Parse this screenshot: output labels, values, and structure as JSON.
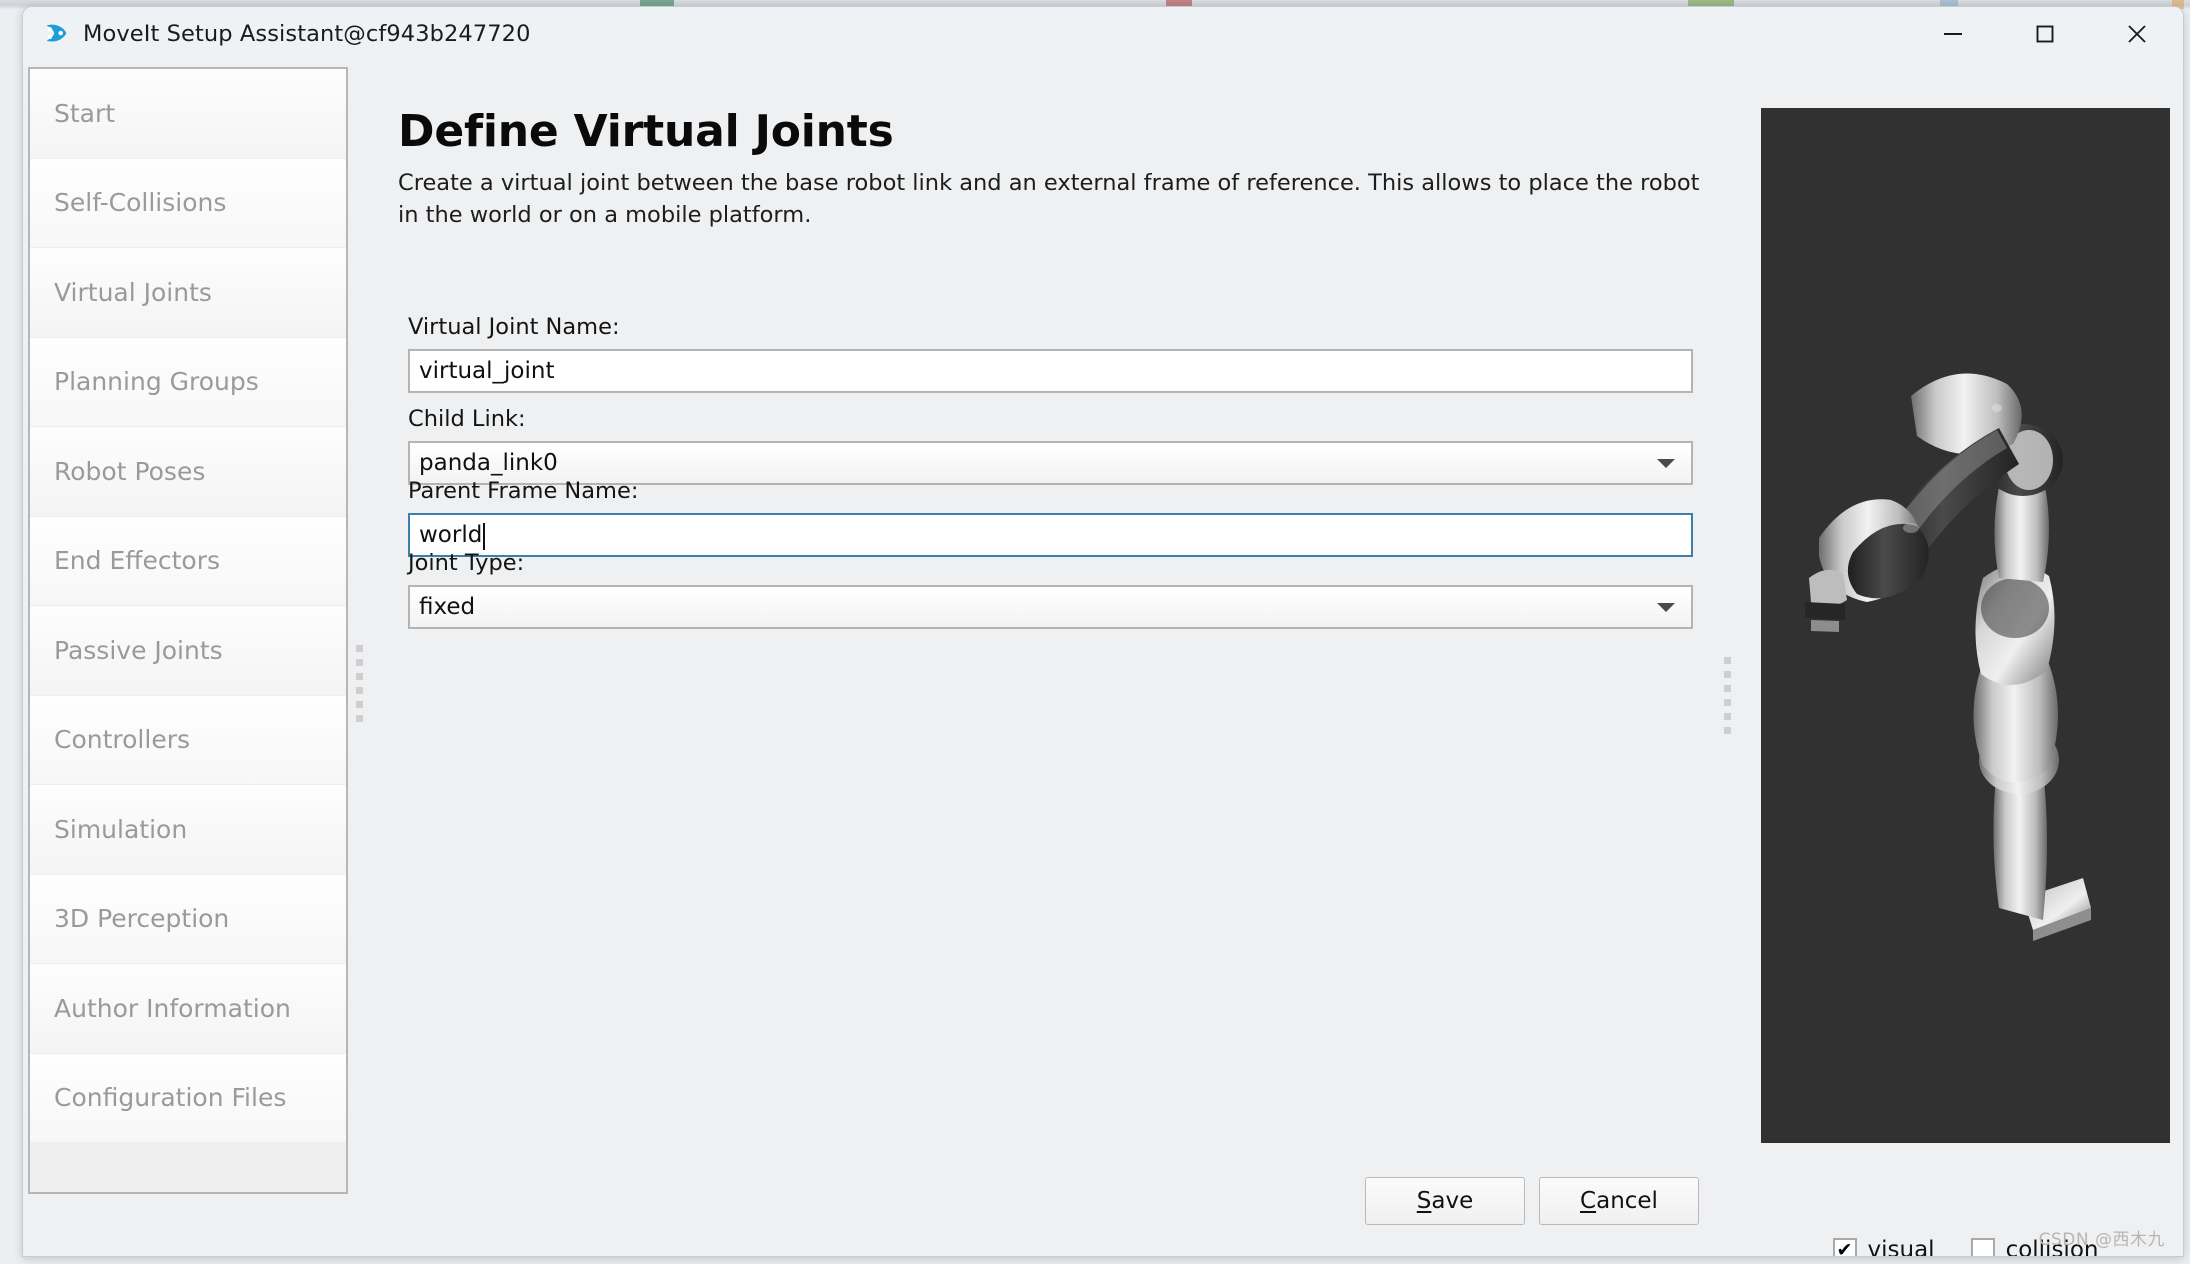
{
  "window": {
    "title": "MoveIt Setup Assistant@cf943b247720",
    "app_icon": "moveit-logo-icon",
    "controls": {
      "minimize": "minimize-icon",
      "maximize": "maximize-icon",
      "close": "close-icon"
    }
  },
  "sidebar": {
    "items": [
      {
        "label": "Start"
      },
      {
        "label": "Self-Collisions"
      },
      {
        "label": "Virtual Joints"
      },
      {
        "label": "Planning Groups"
      },
      {
        "label": "Robot Poses"
      },
      {
        "label": "End Effectors"
      },
      {
        "label": "Passive Joints"
      },
      {
        "label": "Controllers"
      },
      {
        "label": "Simulation"
      },
      {
        "label": "3D Perception"
      },
      {
        "label": "Author Information"
      },
      {
        "label": "Configuration Files"
      }
    ]
  },
  "main": {
    "title": "Define Virtual Joints",
    "description": "Create a virtual joint between the base robot link and an external frame of reference. This allows to place the robot in the world or on a mobile platform.",
    "fields": {
      "virtual_joint_name": {
        "label": "Virtual Joint Name:",
        "value": "virtual_joint",
        "placeholder": ""
      },
      "child_link": {
        "label": "Child Link:",
        "value": "panda_link0",
        "options": [
          "panda_link0"
        ]
      },
      "parent_frame_name": {
        "label": "Parent Frame Name:",
        "value": "world",
        "placeholder": "",
        "focused": true
      },
      "joint_type": {
        "label": "Joint Type:",
        "value": "fixed",
        "options": [
          "fixed"
        ]
      }
    },
    "buttons": {
      "save": {
        "prefix": "",
        "mnemonic": "S",
        "suffix": "ave"
      },
      "cancel": {
        "prefix": "",
        "mnemonic": "C",
        "suffix": "ancel"
      }
    }
  },
  "view3d": {
    "background_color": "#313131",
    "robot": "franka-panda-arm",
    "options": [
      {
        "label": "visual",
        "checked": true,
        "mark": "✔"
      },
      {
        "label": "collision",
        "checked": false,
        "mark": "✔"
      }
    ]
  },
  "watermark": "CSDN @西木九",
  "colors": {
    "focus_border": "#3d7fab",
    "window_chrome": "#eef2f5",
    "panel_bg": "#eff0f1",
    "viewport_bg": "#313131",
    "nav_text": "#9a9a9a"
  }
}
